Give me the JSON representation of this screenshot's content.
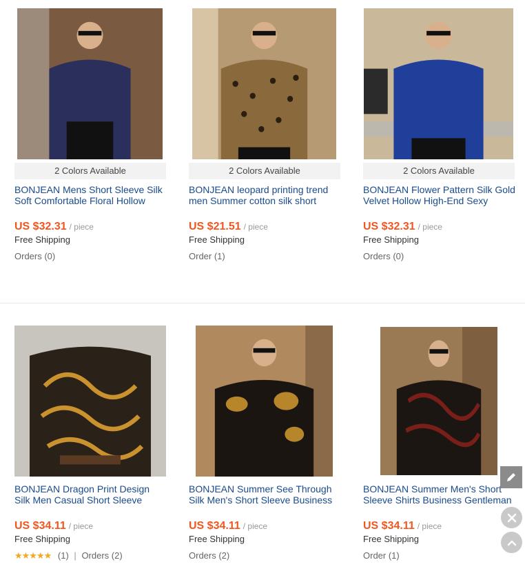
{
  "products": [
    {
      "colors": "2 Colors Available",
      "title": "BONJEAN Mens Short Sleeve Silk Soft Comfortable Floral Hollow",
      "price": "US $32.31",
      "unit": "/ piece",
      "shipping": "Free Shipping",
      "orders": "Orders (0)",
      "shirt_color": "#2a2f5c",
      "bg_color": "#7a5a40"
    },
    {
      "colors": "2 Colors Available",
      "title": "BONJEAN leopard printing trend men Summer cotton silk short",
      "price": "US $21.51",
      "unit": "/ piece",
      "shipping": "Free Shipping",
      "orders": "Order (1)",
      "shirt_color": "#8a6a3c",
      "bg_color": "#b59a74"
    },
    {
      "colors": "2 Colors Available",
      "title": "BONJEAN Flower Pattern Silk Gold Velvet Hollow High-End Sexy",
      "price": "US $32.31",
      "unit": "/ piece",
      "shipping": "Free Shipping",
      "orders": "Orders (0)",
      "shirt_color": "#1f3f9a",
      "bg_color": "#c9b89a"
    },
    {
      "title": "BONJEAN Dragon Print Design Silk Men Casual Short Sleeve",
      "price": "US $34.11",
      "unit": "/ piece",
      "shipping": "Free Shipping",
      "rating_stars": "★★★★★",
      "rating_count": "(1)",
      "separator": "|",
      "orders": "Orders (2)",
      "shirt_color": "#2a2118",
      "bg_color": "#c8c4be"
    },
    {
      "title": "BONJEAN Summer See Through Silk Men's Short Sleeve Business",
      "price": "US $34.11",
      "unit": "/ piece",
      "shipping": "Free Shipping",
      "orders": "Orders (2)",
      "shirt_color": "#1a1510",
      "bg_color": "#b08a5e"
    },
    {
      "title": "BONJEAN Summer Men's Short Sleeve Shirts Business Gentleman",
      "price": "US $34.11",
      "unit": "/ piece",
      "shipping": "Free Shipping",
      "orders": "Order (1)",
      "shirt_color": "#1c1612",
      "bg_color": "#9a7a55"
    }
  ],
  "floating": {
    "edit_icon": "pencil-icon",
    "close_icon": "close-icon",
    "top_icon": "chevron-up-icon"
  },
  "colors": {
    "price": "#f0561f",
    "title_link": "#1a4b8c",
    "stars": "#f5a623"
  }
}
